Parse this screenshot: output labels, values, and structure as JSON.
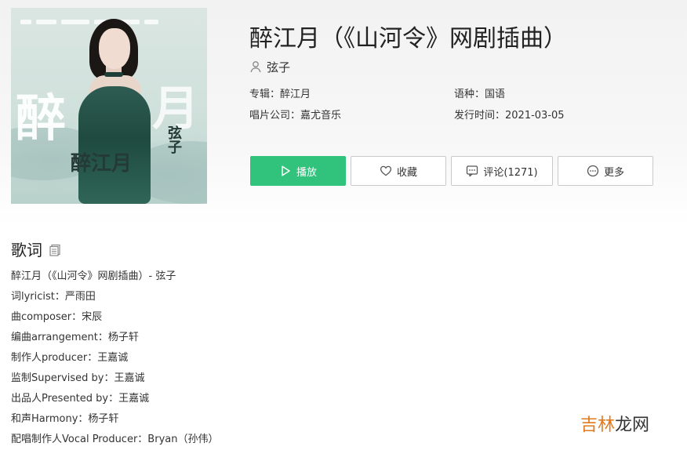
{
  "song": {
    "title": "醉江月（《山河令》网剧插曲）",
    "singer": "弦子",
    "cover_text": {
      "large_left": "醉",
      "large_right": "月",
      "small": "醉江月",
      "artist": "弦子"
    },
    "meta": {
      "album_label": "专辑：",
      "album_value": "醉江月",
      "language_label": "语种：",
      "language_value": "国语",
      "company_label": "唱片公司：",
      "company_value": "嘉尤音乐",
      "release_label": "发行时间：",
      "release_value": "2021-03-05"
    }
  },
  "actions": {
    "play_label": "播放",
    "favorite_label": "收藏",
    "comment_label": "评论(1271)",
    "more_label": "更多"
  },
  "lyrics": {
    "heading": "歌词",
    "lines": [
      "醉江月（《山河令》网剧插曲）- 弦子",
      "词lyricist：严雨田",
      "曲composer：宋辰",
      "编曲arrangement：杨子轩",
      "制作人producer：王嘉诚",
      "监制Supervised by：王嘉诚",
      "出品人Presented by：王嘉诚",
      "和声Harmony：杨子轩",
      "配唱制作人Vocal Producer：Bryan（孙伟）"
    ]
  },
  "watermark": {
    "part1": "吉林",
    "part2": "龙网"
  },
  "colors": {
    "accent_green": "#31c27c",
    "watermark_orange": "#e07a1f"
  },
  "icons": {
    "singer": "user-icon",
    "play": "play-icon",
    "favorite": "heart-icon",
    "comment": "comment-icon",
    "more": "more-icon",
    "copy": "copy-icon"
  }
}
